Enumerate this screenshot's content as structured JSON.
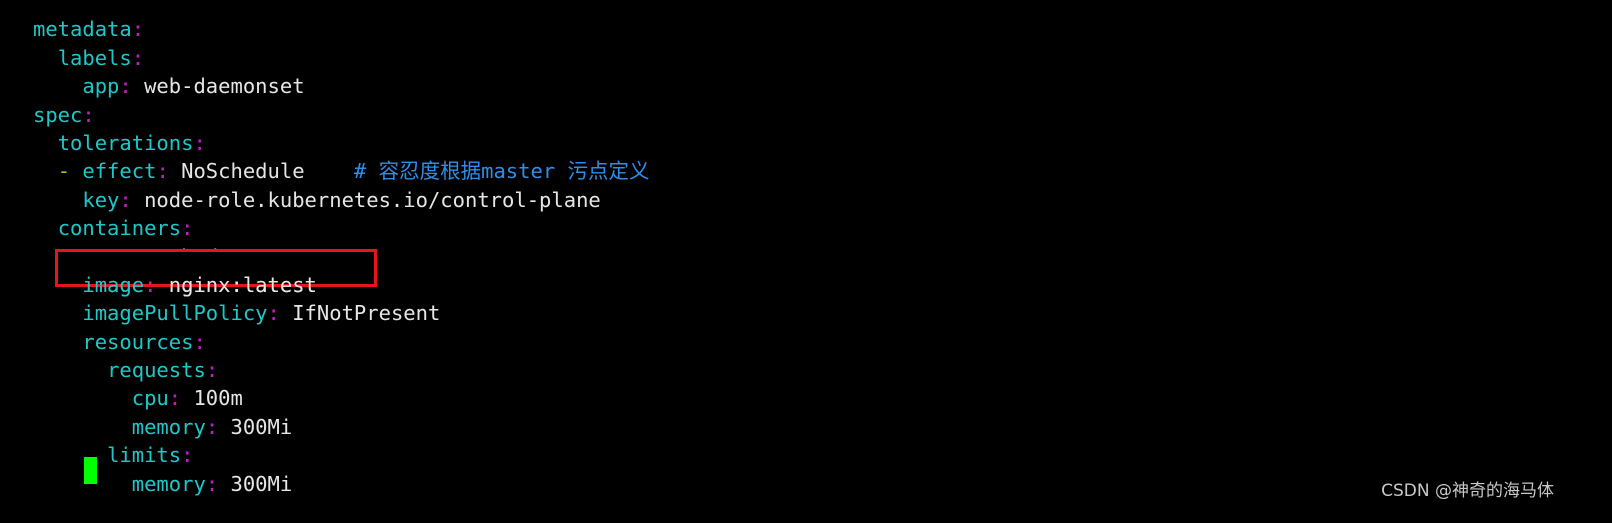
{
  "terminal": {
    "lines": [
      {
        "indent": "",
        "dash": "",
        "key": "",
        "colon": "",
        "value": "",
        "partial_char": "'"
      },
      {
        "indent": "",
        "dash": "",
        "key": "metadata",
        "colon": ":",
        "value": ""
      },
      {
        "indent": "  ",
        "dash": "",
        "key": "labels",
        "colon": ":",
        "value": ""
      },
      {
        "indent": "    ",
        "dash": "",
        "key": "app",
        "colon": ":",
        "value": " web-daemonset"
      },
      {
        "indent": "",
        "dash": "",
        "key": "spec",
        "colon": ":",
        "value": ""
      },
      {
        "indent": "  ",
        "dash": "",
        "key": "tolerations",
        "colon": ":",
        "value": ""
      },
      {
        "indent": "  ",
        "dash": "- ",
        "key": "effect",
        "colon": ":",
        "value": " NoSchedule    ",
        "comment": "# 容忍度根据master 污点定义"
      },
      {
        "indent": "    ",
        "dash": "",
        "key": "key",
        "colon": ":",
        "value": " node-role.kubernetes.io/control-plane"
      },
      {
        "indent": "  ",
        "dash": "",
        "key": "containers",
        "colon": ":",
        "value": ""
      },
      {
        "indent": "  ",
        "dash": "- ",
        "key": "name",
        "colon": ":",
        "value": " web-daemonset"
      },
      {
        "indent": "    ",
        "dash": "",
        "key": "image",
        "colon": ":",
        "value": " nginx:latest",
        "highlighted": true
      },
      {
        "indent": "    ",
        "dash": "",
        "key": "imagePullPolicy",
        "colon": ":",
        "value": " IfNotPresent"
      },
      {
        "indent": "    ",
        "dash": "",
        "key": "resources",
        "colon": ":",
        "value": ""
      },
      {
        "indent": "      ",
        "dash": "",
        "key": "requests",
        "colon": ":",
        "value": ""
      },
      {
        "indent": "        ",
        "dash": "",
        "key": "cpu",
        "colon": ":",
        "value": " 100m"
      },
      {
        "indent": "        ",
        "dash": "",
        "key": "memory",
        "colon": ":",
        "value": " 300Mi"
      },
      {
        "indent": "      ",
        "dash": "",
        "key": "limits",
        "colon": ":",
        "value": ""
      },
      {
        "indent": "        ",
        "dash": "",
        "key": "memory",
        "colon": ":",
        "value": " 300Mi"
      }
    ],
    "highlight_color": "#e8141c",
    "cursor_color": "#00ff00"
  },
  "watermark": {
    "text": "CSDN @神奇的海马体"
  },
  "colors": {
    "background": "#000000",
    "key": "#1ec8c8",
    "colon": "#c020c0",
    "value": "#e6e6e6",
    "dash": "#c8b400",
    "comment": "#2e8fea"
  }
}
